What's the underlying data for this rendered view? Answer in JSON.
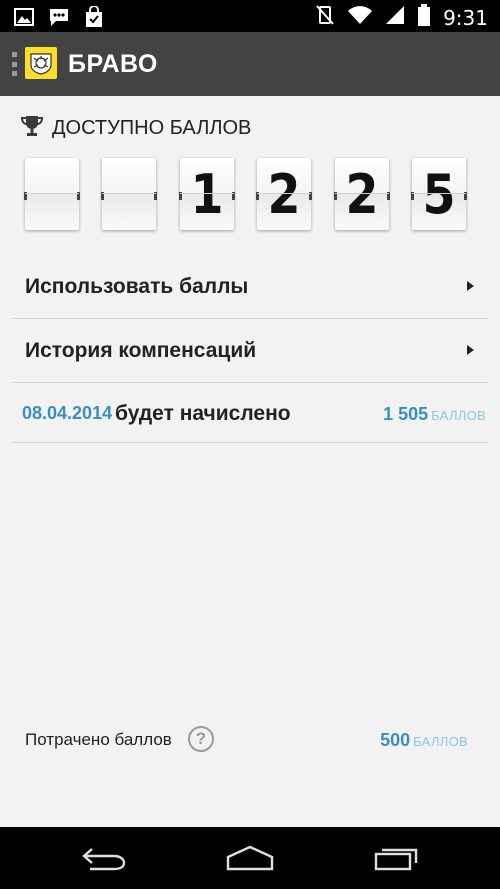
{
  "status_bar": {
    "time": "9:31",
    "left_icons": [
      "image-icon",
      "chat-icon",
      "shopping-bag-icon"
    ],
    "right_icons": [
      "vibrate-off-icon",
      "wifi-icon",
      "signal-icon",
      "battery-icon"
    ]
  },
  "action_bar": {
    "title": "БРАВО",
    "logo_color": "#ffdd2d",
    "background": "#434343"
  },
  "balance": {
    "label": "ДОСТУПНО БАЛЛОВ",
    "icon": "trophy-icon",
    "digits": [
      "",
      "",
      "1",
      "2",
      "2",
      "5"
    ]
  },
  "menu": [
    {
      "label": "Использовать баллы"
    },
    {
      "label": "История компенсаций"
    }
  ],
  "accrual": {
    "date": "08.04.2014",
    "text": "будет начислено",
    "amount": "1 505",
    "unit": "БАЛЛОВ"
  },
  "spent": {
    "label": "Потрачено баллов",
    "help": "?",
    "amount": "500",
    "unit": "БАЛЛОВ"
  },
  "colors": {
    "accent": "#3a8fc0",
    "accent_light": "#8ec6e2",
    "background": "#f2f2f2"
  },
  "nav_bar": {
    "buttons": [
      "back-icon",
      "home-icon",
      "recent-apps-icon"
    ]
  }
}
